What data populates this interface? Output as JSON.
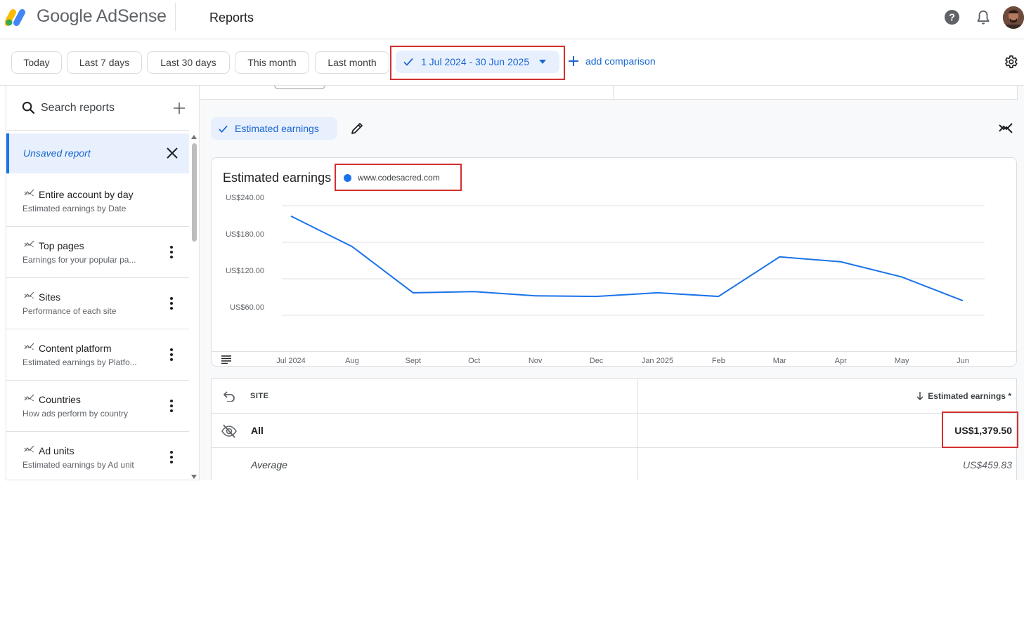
{
  "header": {
    "brand": "Google AdSense",
    "page_title": "Reports"
  },
  "filters": {
    "chips": [
      "Today",
      "Last 7 days",
      "Last 30 days",
      "This month",
      "Last month"
    ],
    "date_range": "1 Jul 2024 - 30 Jun 2025",
    "add_comparison": "add comparison"
  },
  "sidebar": {
    "search_placeholder": "Search reports",
    "unsaved_report": "Unsaved report",
    "items": [
      {
        "title": "Entire account by day",
        "subtitle": "Estimated earnings by Date",
        "has_menu": false
      },
      {
        "title": "Top pages",
        "subtitle": "Earnings for your popular pa...",
        "has_menu": true
      },
      {
        "title": "Sites",
        "subtitle": "Performance of each site",
        "has_menu": true
      },
      {
        "title": "Content platform",
        "subtitle": "Estimated earnings by Platfo...",
        "has_menu": true
      },
      {
        "title": "Countries",
        "subtitle": "How ads perform by country",
        "has_menu": true
      },
      {
        "title": "Ad units",
        "subtitle": "Estimated earnings by Ad unit",
        "has_menu": true
      }
    ]
  },
  "main": {
    "metric_chip": "Estimated earnings",
    "chart_title": "Estimated earnings",
    "legend_site": "www.codesacred.com",
    "table": {
      "col_site": "SITE",
      "col_earnings": "Estimated earnings *",
      "all_label": "All",
      "all_value": "US$1,379.50",
      "avg_label": "Average",
      "avg_value": "US$459.83"
    }
  },
  "colors": {
    "accent": "#1a73e8",
    "highlight_box": "#d32f2f"
  },
  "chart_data": {
    "type": "line",
    "x": [
      "Jul 2024",
      "Aug",
      "Sept",
      "Oct",
      "Nov",
      "Dec",
      "Jan 2025",
      "Feb",
      "Mar",
      "Apr",
      "May",
      "Jun"
    ],
    "series": [
      {
        "name": "www.codesacred.com",
        "values": [
          223,
          173,
          97,
          99,
          92,
          91,
          97,
          91,
          156,
          148,
          123,
          84
        ]
      }
    ],
    "y_ticks": [
      "US$240.00",
      "US$180.00",
      "US$120.00",
      "US$60.00"
    ],
    "ylim": [
      60,
      240
    ],
    "grid": true,
    "legend": "top-left"
  }
}
